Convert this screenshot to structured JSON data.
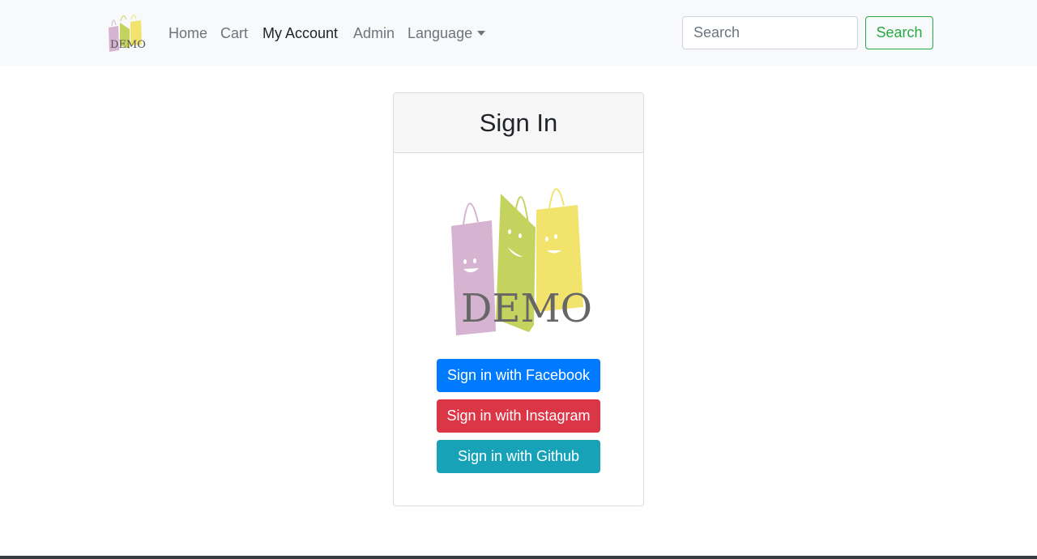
{
  "navbar": {
    "logo_text": "DEMO",
    "links": [
      {
        "label": "Home"
      },
      {
        "label": "Cart"
      },
      {
        "label": "My Account"
      },
      {
        "label": "Admin"
      },
      {
        "label": "Language"
      }
    ],
    "search": {
      "placeholder": "Search",
      "value": "",
      "button_label": "Search"
    }
  },
  "signin": {
    "title": "Sign In",
    "logo_text": "DEMO",
    "buttons": [
      {
        "label": "Sign in with Facebook",
        "color": "#007bff"
      },
      {
        "label": "Sign in with Instagram",
        "color": "#dc3545"
      },
      {
        "label": "Sign in with Github",
        "color": "#17a2b8"
      }
    ]
  },
  "icons": {
    "dropdown": "chevron-down-icon",
    "logo": "shopping-bags-logo"
  },
  "colors": {
    "navbar_bg": "#f8f9fa",
    "search_accent": "#28a745",
    "bag_pink": "#d5b3d1",
    "bag_green": "#c3d35d",
    "bag_yellow": "#f2e36c"
  }
}
